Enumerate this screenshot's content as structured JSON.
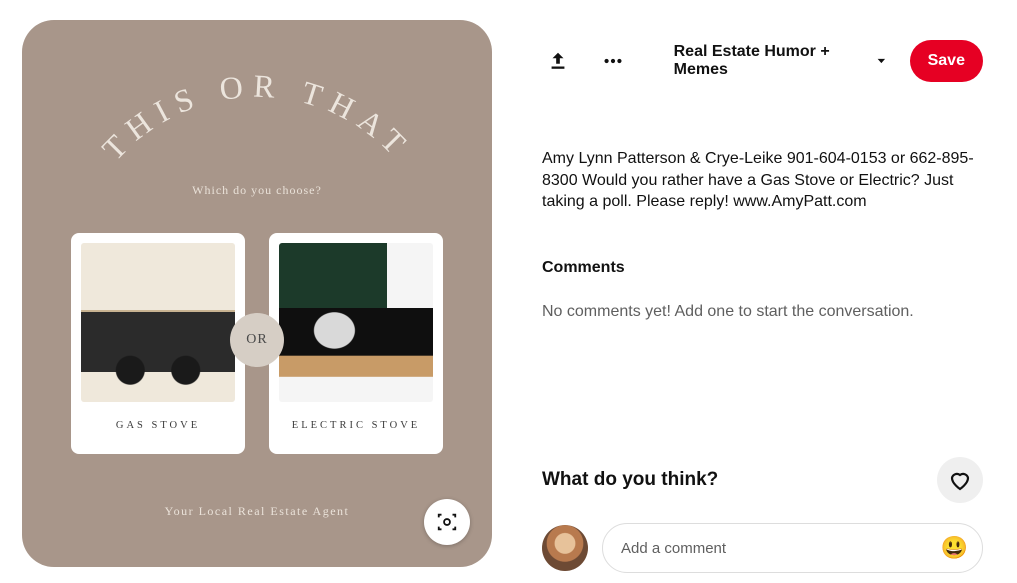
{
  "pin": {
    "arc_title": "THIS OR THAT",
    "subtitle": "Which do you choose?",
    "or_label": "OR",
    "card_left": {
      "caption": "GAS STOVE"
    },
    "card_right": {
      "caption": "ELECTRIC STOVE"
    },
    "footer": "Your Local Real Estate Agent",
    "bg_color": "#a8968a"
  },
  "actions": {
    "board_name": "Real Estate Humor + Memes",
    "save_label": "Save"
  },
  "description": "Amy Lynn Patterson & Crye-Leike 901-604-0153 or 662-895-8300 Would you rather have a Gas Stove or Electric? Just taking a poll. Please reply! www.AmyPatt.com",
  "comments": {
    "heading": "Comments",
    "empty_text": "No comments yet! Add one to start the conversation."
  },
  "composer": {
    "prompt": "What do you think?",
    "placeholder": "Add a comment"
  },
  "icons": {
    "share": "share-icon",
    "more": "more-icon",
    "lens": "visual-search-icon",
    "chevron": "chevron-down-icon",
    "heart": "heart-icon",
    "emoji": "😃"
  }
}
